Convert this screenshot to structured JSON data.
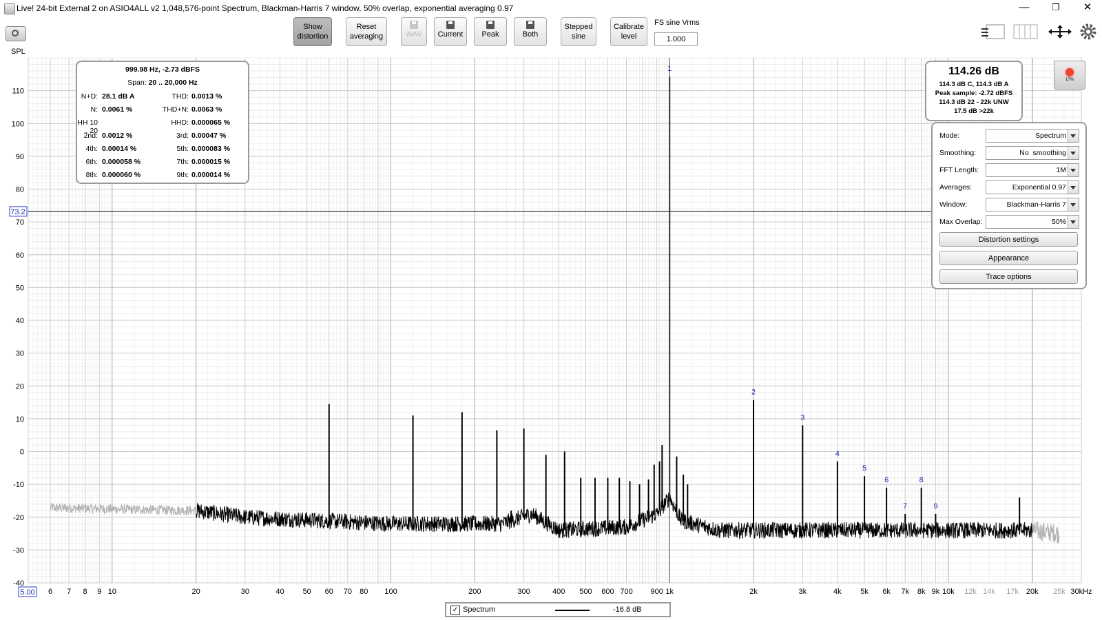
{
  "window": {
    "title": "Live! 24-bit External 2 on ASIO4ALL v2 1,048,576-point Spectrum, Blackman-Harris 7 window, 50% overlap, exponential averaging 0.97",
    "minimize": "—",
    "restore": "❐",
    "close": "✕"
  },
  "toolbar": {
    "show_distortion": [
      "Show",
      "distortion"
    ],
    "reset_averaging": [
      "Reset",
      "averaging"
    ],
    "wav": "WAV",
    "current": "Current",
    "peak": "Peak",
    "both": "Both",
    "stepped_sine": [
      "Stepped",
      "sine"
    ],
    "calibrate_level": [
      "Calibrate",
      "level"
    ],
    "fs_sine_label": "FS sine Vrms",
    "fs_sine_value": "1.000"
  },
  "axis": {
    "y_title": "SPL"
  },
  "distortion": {
    "header": "999.98 Hz, -2.73 dBFS",
    "span_label": "Span:",
    "span_value": "20 .. 20,000 Hz",
    "rows": [
      {
        "l1": "N+D:",
        "v1": "28.1 dB A",
        "l2": "THD:",
        "v2": "0.0013 %"
      },
      {
        "l1": "N:",
        "v1": "0.0061 %",
        "l2": "THD+N:",
        "v2": "0.0063 %"
      },
      {
        "l1": "HH 10 .. 20",
        "v1": "",
        "l2": "HHD:",
        "v2": "0.000065 %"
      },
      {
        "l1": "2nd:",
        "v1": "0.0012 %",
        "l2": "3rd:",
        "v2": "0.00047 %"
      },
      {
        "l1": "4th:",
        "v1": "0.00014 %",
        "l2": "5th:",
        "v2": "0.000083 %"
      },
      {
        "l1": "6th:",
        "v1": "0.000058 %",
        "l2": "7th:",
        "v2": "0.000015 %"
      },
      {
        "l1": "8th:",
        "v1": "0.000060 %",
        "l2": "9th:",
        "v2": "0.000014 %"
      }
    ]
  },
  "level": {
    "main": "114.26 dB",
    "lines": [
      "114.3 dB C, 114.3 dB A",
      "Peak sample: -2.72 dBFS",
      "114.3 dB 22 - 22k UNW",
      "17.5 dB >22k"
    ]
  },
  "record": {
    "percent": "17%"
  },
  "controls": {
    "mode": {
      "label": "Mode:",
      "value": "Spectrum"
    },
    "smoothing": {
      "label": "Smoothing:",
      "value": "No  smoothing"
    },
    "fft_length": {
      "label": "FFT Length:",
      "value": "1M"
    },
    "averages": {
      "label": "Averages:",
      "value": "Exponential 0.97"
    },
    "window": {
      "label": "Window:",
      "value": "Blackman-Harris 7"
    },
    "max_overlap": {
      "label": "Max Overlap:",
      "value": "50%"
    },
    "distortion_settings": "Distortion settings",
    "appearance": "Appearance",
    "trace_options": "Trace options"
  },
  "legend": {
    "check": "✓",
    "name": "Spectrum",
    "value": "-16.8 dB"
  },
  "chart_data": {
    "type": "line",
    "x_scale": "log",
    "xlim": [
      5,
      30000
    ],
    "ylim": [
      -40,
      120
    ],
    "grid": true,
    "ylabel": "SPL",
    "y_ticks": [
      110,
      100,
      90,
      80,
      70,
      60,
      50,
      40,
      30,
      20,
      10,
      0,
      -10,
      -20,
      -30,
      -40
    ],
    "x_ticks": [
      {
        "v": 6,
        "t": "6"
      },
      {
        "v": 7,
        "t": "7"
      },
      {
        "v": 8,
        "t": "8"
      },
      {
        "v": 9,
        "t": "9"
      },
      {
        "v": 10,
        "t": "10"
      },
      {
        "v": 20,
        "t": "20"
      },
      {
        "v": 30,
        "t": "30"
      },
      {
        "v": 40,
        "t": "40"
      },
      {
        "v": 50,
        "t": "50"
      },
      {
        "v": 60,
        "t": "60"
      },
      {
        "v": 70,
        "t": "70"
      },
      {
        "v": 80,
        "t": "80"
      },
      {
        "v": 100,
        "t": "100"
      },
      {
        "v": 200,
        "t": "200"
      },
      {
        "v": 300,
        "t": "300"
      },
      {
        "v": 400,
        "t": "400"
      },
      {
        "v": 500,
        "t": "500"
      },
      {
        "v": 600,
        "t": "600"
      },
      {
        "v": 700,
        "t": "700"
      },
      {
        "v": 900,
        "t": "900"
      },
      {
        "v": 1000,
        "t": "1k"
      },
      {
        "v": 2000,
        "t": "2k"
      },
      {
        "v": 3000,
        "t": "3k"
      },
      {
        "v": 4000,
        "t": "4k"
      },
      {
        "v": 5000,
        "t": "5k"
      },
      {
        "v": 6000,
        "t": "6k"
      },
      {
        "v": 7000,
        "t": "7k"
      },
      {
        "v": 8000,
        "t": "8k"
      },
      {
        "v": 9000,
        "t": "9k"
      },
      {
        "v": 10000,
        "t": "10k"
      },
      {
        "v": 12000,
        "t": "12k",
        "gray": true
      },
      {
        "v": 14000,
        "t": "14k",
        "gray": true
      },
      {
        "v": 17000,
        "t": "17k",
        "gray": true
      },
      {
        "v": 20000,
        "t": "20k"
      },
      {
        "v": 25000,
        "t": "25k",
        "gray": true
      },
      {
        "v": 30000,
        "t": "30kHz"
      }
    ],
    "x_start_label": "5.00",
    "cursor_value": 73.2,
    "cursor_label": "73.2",
    "cursor_freq": 1000,
    "series": [
      {
        "name": "Spectrum",
        "color": "#000000",
        "out_of_band_color": "#b3b3b3",
        "analysis_band": [
          20,
          20000
        ],
        "noise_floor": [
          [
            5,
            -17
          ],
          [
            20,
            -18
          ],
          [
            30,
            -20
          ],
          [
            100,
            -22
          ],
          [
            250,
            -22
          ],
          [
            320,
            -19
          ],
          [
            400,
            -24
          ],
          [
            700,
            -23
          ],
          [
            900,
            -19
          ],
          [
            1000,
            -14
          ],
          [
            1100,
            -21
          ],
          [
            1500,
            -24
          ],
          [
            20000,
            -24
          ],
          [
            25000,
            -25
          ]
        ],
        "peaks": [
          {
            "f": 60,
            "db": 14.5
          },
          {
            "f": 120,
            "db": 11
          },
          {
            "f": 180,
            "db": 12
          },
          {
            "f": 240,
            "db": 6.5
          },
          {
            "f": 270,
            "db": -18
          },
          {
            "f": 300,
            "db": 7
          },
          {
            "f": 360,
            "db": -1
          },
          {
            "f": 420,
            "db": 0
          },
          {
            "f": 480,
            "db": -8
          },
          {
            "f": 540,
            "db": -8
          },
          {
            "f": 600,
            "db": -8
          },
          {
            "f": 660,
            "db": -8
          },
          {
            "f": 720,
            "db": -9
          },
          {
            "f": 780,
            "db": -10
          },
          {
            "f": 840,
            "db": -8.5
          },
          {
            "f": 880,
            "db": -4
          },
          {
            "f": 920,
            "db": -3
          },
          {
            "f": 940,
            "db": 2
          },
          {
            "f": 1000,
            "db": 114.3
          },
          {
            "f": 1060,
            "db": -1.5
          },
          {
            "f": 1120,
            "db": -7
          },
          {
            "f": 1160,
            "db": -10
          },
          {
            "f": 2000,
            "db": 15.7
          },
          {
            "f": 3000,
            "db": 8
          },
          {
            "f": 4000,
            "db": -3
          },
          {
            "f": 5000,
            "db": -7.5
          },
          {
            "f": 6000,
            "db": -11
          },
          {
            "f": 7000,
            "db": -19
          },
          {
            "f": 8000,
            "db": -11
          },
          {
            "f": 9000,
            "db": -19
          },
          {
            "f": 18000,
            "db": -14
          }
        ]
      }
    ],
    "harmonic_markers": [
      {
        "n": "1",
        "f": 1000,
        "db": 114.3
      },
      {
        "n": "2",
        "f": 2000,
        "db": 15.7
      },
      {
        "n": "3",
        "f": 3000,
        "db": 8
      },
      {
        "n": "4",
        "f": 4000,
        "db": -3
      },
      {
        "n": "5",
        "f": 5000,
        "db": -7.5
      },
      {
        "n": "6",
        "f": 6000,
        "db": -11
      },
      {
        "n": "7",
        "f": 7000,
        "db": -19
      },
      {
        "n": "8",
        "f": 8000,
        "db": -11
      },
      {
        "n": "9",
        "f": 9000,
        "db": -19
      }
    ]
  }
}
